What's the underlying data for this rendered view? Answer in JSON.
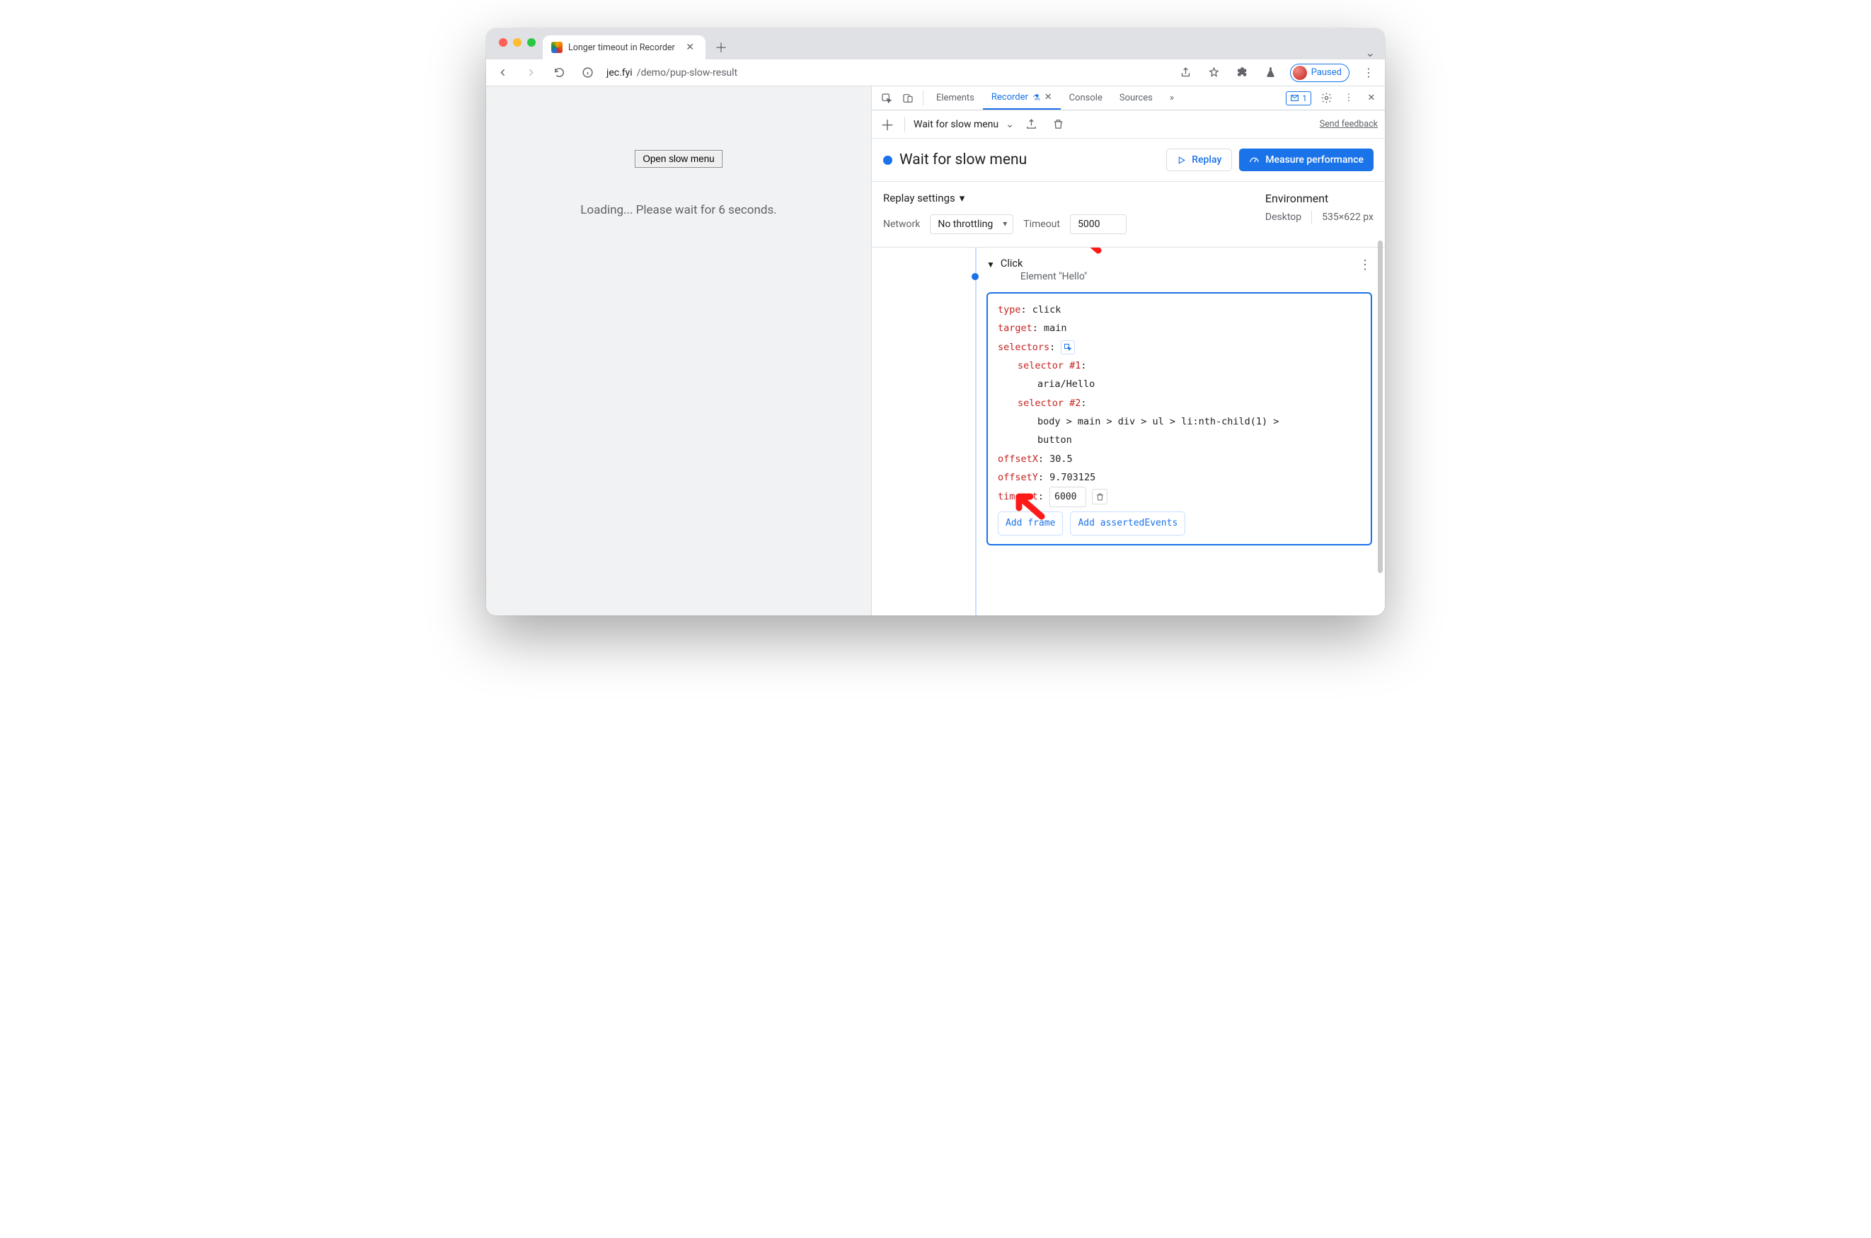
{
  "browser": {
    "tab_title": "Longer timeout in Recorder",
    "url_host": "jec.fyi",
    "url_path": "/demo/pup-slow-result",
    "profile_label": "Paused"
  },
  "page": {
    "button_label": "Open slow menu",
    "loading_text": "Loading... Please wait for 6 seconds."
  },
  "devtools": {
    "tabs": {
      "elements": "Elements",
      "recorder": "Recorder",
      "console": "Console",
      "sources": "Sources"
    },
    "issue_count": "1",
    "feedback_link": "Send feedback"
  },
  "recorder": {
    "recording_name": "Wait for slow menu",
    "title": "Wait for slow menu",
    "replay_label": "Replay",
    "measure_label": "Measure performance",
    "settings_title": "Replay settings",
    "network_label": "Network",
    "network_value": "No throttling",
    "timeout_label": "Timeout",
    "timeout_value": "5000",
    "env_title": "Environment",
    "env_device": "Desktop",
    "env_viewport": "535×622 px"
  },
  "step": {
    "name": "Click",
    "subtitle": "Element \"Hello\"",
    "fields": {
      "type_k": "type",
      "type_v": "click",
      "target_k": "target",
      "target_v": "main",
      "selectors_k": "selectors",
      "sel1_k": "selector #1",
      "sel1_v": "aria/Hello",
      "sel2_k": "selector #2",
      "sel2_v": "body > main > div > ul > li:nth-child(1) > button",
      "offx_k": "offsetX",
      "offx_v": "30.5",
      "offy_k": "offsetY",
      "offy_v": "9.703125",
      "timeout_k": "timeout",
      "timeout_v": "6000",
      "add_frame": "Add frame",
      "add_asserted": "Add assertedEvents"
    }
  }
}
